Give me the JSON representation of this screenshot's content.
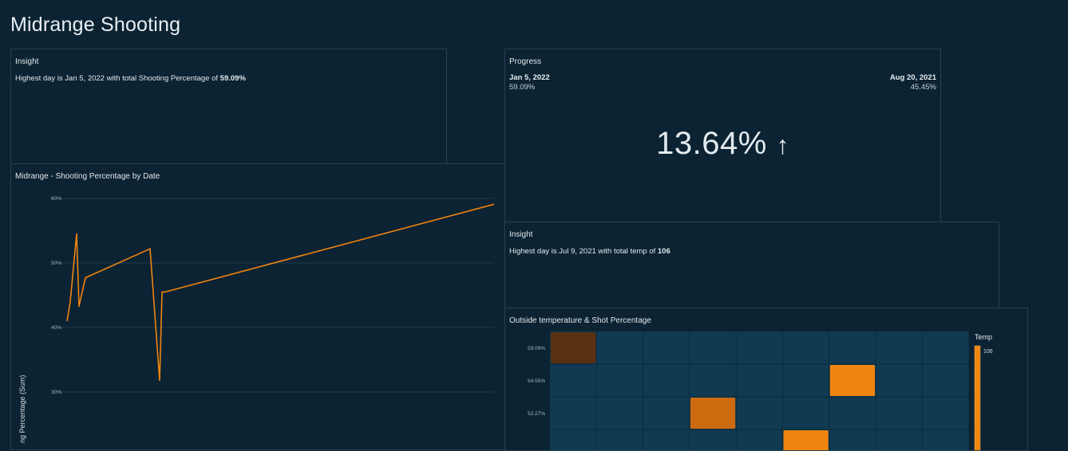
{
  "page": {
    "title": "Midrange Shooting"
  },
  "insight1": {
    "title": "Insight",
    "prefix": "Highest day is Jan 5, 2022 with total Shooting Percentage of ",
    "value": "59.09%"
  },
  "progress": {
    "title": "Progress",
    "left_date": "Jan 5, 2022",
    "left_value": "59.09%",
    "right_date": "Aug 20, 2021",
    "right_value": "45.45%",
    "kpi": "13.64%",
    "arrow_icon": "arrow-up-icon"
  },
  "insight2": {
    "title": "Insight",
    "prefix": "Highest day is Jul 9, 2021 with total temp of ",
    "value": "106"
  },
  "line_chart": {
    "title": "Midrange - Shooting Percentage by Date",
    "ylabel_visible": "ng Percentage (Sum)",
    "ticks": [
      "60%",
      "50%",
      "40%",
      "30%"
    ]
  },
  "heatmap": {
    "title": "Outside temperature & Shot Percentage",
    "legend_title": "Temp",
    "legend_max": "106",
    "row_labels": [
      "59.09%",
      "54.55%",
      "52.27%"
    ]
  },
  "colors": {
    "background": "#0b2333",
    "line": "#f0850f",
    "heatmap_cell": "#0f3a51",
    "accent_orange": "#f0850f",
    "accent_brown": "#5a3012",
    "accent_dark_orange": "#cc6a0f"
  },
  "chart_data": [
    {
      "type": "line",
      "title": "Midrange - Shooting Percentage by Date",
      "ylabel": "Shooting Percentage (Sum)",
      "ylim": [
        30,
        60
      ],
      "yticks": [
        60,
        50,
        40,
        30
      ],
      "grid": true,
      "series": [
        {
          "values": [
            41.0,
            44.0,
            54.5,
            43.3,
            47.7,
            52.2,
            31.8,
            45.5,
            45.5,
            59.1
          ]
        }
      ]
    },
    {
      "type": "heatmap",
      "title": "Outside temperature & Shot Percentage",
      "y_categories": [
        "59.09%",
        "54.55%",
        "52.27%"
      ],
      "legend": "Temp",
      "legend_max": 106,
      "highlighted_cells": [
        {
          "row": 0,
          "col": 0,
          "color": "#5a3012"
        },
        {
          "row": 1,
          "col": 6,
          "color": "#f0850f"
        },
        {
          "row": 2,
          "col": 3,
          "color": "#cc6a0f"
        },
        {
          "row": 3,
          "col": 5,
          "color": "#f0850f"
        }
      ]
    }
  ]
}
